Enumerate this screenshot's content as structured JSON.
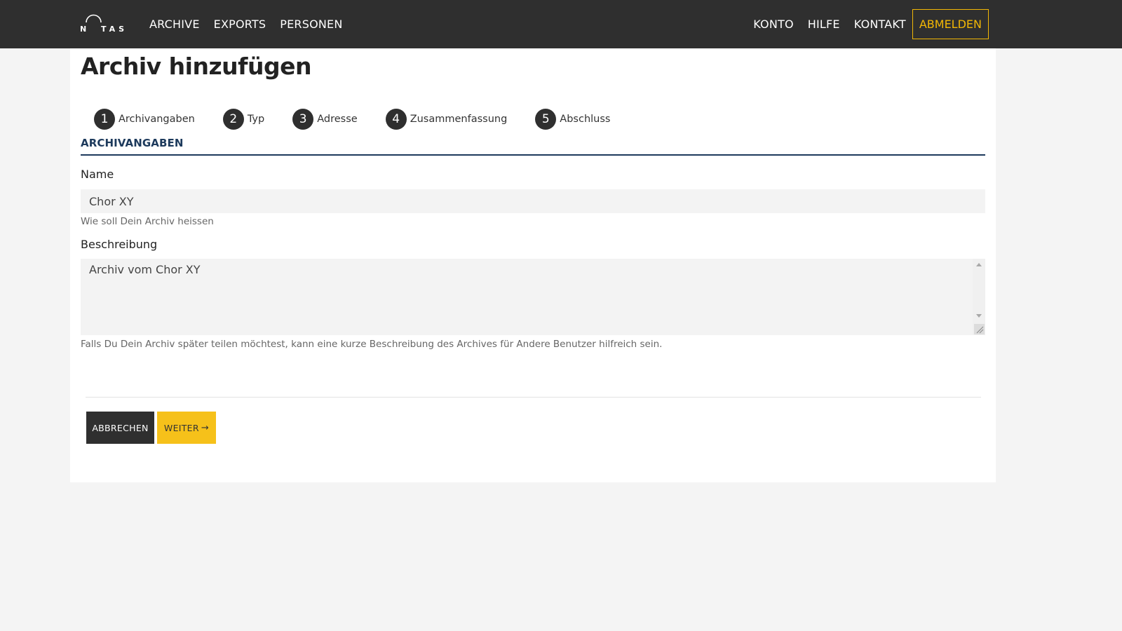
{
  "header": {
    "logo_text": "N TAS",
    "nav_left": [
      "ARCHIVE",
      "EXPORTS",
      "PERSONEN"
    ],
    "nav_right": [
      "KONTO",
      "HILFE",
      "KONTAKT"
    ],
    "logout_label": "ABMELDEN",
    "colors": {
      "bar": "#2f2f2f",
      "accent": "#f2b705"
    }
  },
  "page": {
    "title": "Archiv hinzufügen"
  },
  "steps": [
    {
      "number": "1",
      "label": "Archivangaben"
    },
    {
      "number": "2",
      "label": "Typ"
    },
    {
      "number": "3",
      "label": "Adresse"
    },
    {
      "number": "4",
      "label": "Zusammenfassung"
    },
    {
      "number": "5",
      "label": "Abschluss"
    }
  ],
  "form": {
    "section_title": "ARCHIVANGABEN",
    "name": {
      "label": "Name",
      "value": "Chor XY",
      "help": "Wie soll Dein Archiv heissen"
    },
    "description": {
      "label": "Beschreibung",
      "value": "Archiv vom Chor XY",
      "help": "Falls Du Dein Archiv später teilen möchtest, kann eine kurze Beschreibung des Archives für Andere Benutzer hilfreich sein."
    }
  },
  "actions": {
    "cancel_label": "ABBRECHEN",
    "next_label": "WEITER",
    "next_icon": "arrow-right-icon",
    "colors": {
      "cancel_bg": "#2f2f2f",
      "next_bg": "#f6c11a"
    }
  }
}
